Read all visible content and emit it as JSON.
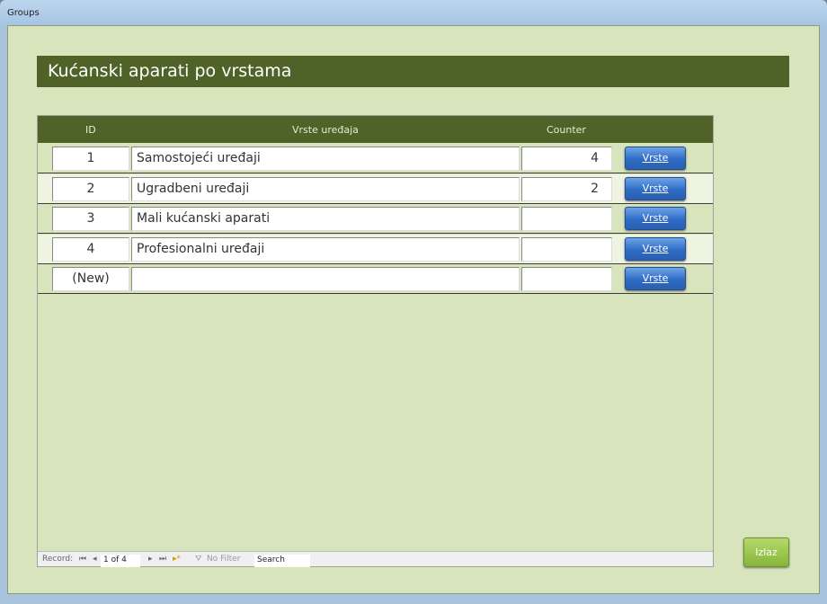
{
  "window": {
    "title": "Groups"
  },
  "form": {
    "title": "Kućanski aparati po vrstama"
  },
  "columns": {
    "id": "ID",
    "name": "Vrste uređaja",
    "counter": "Counter"
  },
  "rows": [
    {
      "id": "1",
      "name": "Samostojeći uređaji",
      "counter": "4",
      "button": "Vrste"
    },
    {
      "id": "2",
      "name": "Ugradbeni uređaji",
      "counter": "2",
      "button": "Vrste"
    },
    {
      "id": "3",
      "name": "Mali kućanski aparati",
      "counter": "",
      "button": "Vrste"
    },
    {
      "id": "4",
      "name": "Profesionalni uređaji",
      "counter": "",
      "button": "Vrste"
    },
    {
      "id": "(New)",
      "name": "",
      "counter": "",
      "button": "Vrste"
    }
  ],
  "nav": {
    "label": "Record:",
    "first": "⏮",
    "prev": "◂",
    "position": "1 of 4",
    "next": "▸",
    "last": "⏭",
    "new": "▸*",
    "filter": "No Filter",
    "search": "Search"
  },
  "exit_button": "Izlaz"
}
